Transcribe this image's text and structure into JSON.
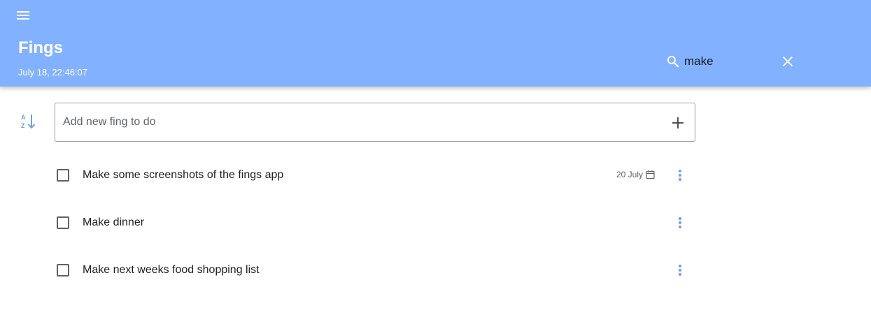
{
  "app": {
    "title": "Fings",
    "timestamp": "July 18, 22:46:07"
  },
  "search": {
    "value": "make",
    "icon": "search-icon",
    "clear_icon": "close-icon"
  },
  "toolbar": {
    "menu_icon": "menu-icon",
    "sort_icon": "sort-alpha-icon"
  },
  "add_todo": {
    "placeholder": "Add new fing to do",
    "add_icon": "plus-icon"
  },
  "todos": [
    {
      "text": "Make some screenshots of the fings app",
      "due": "20 July",
      "checked": false
    },
    {
      "text": "Make dinner",
      "due": "",
      "checked": false
    },
    {
      "text": "Make next weeks food shopping list",
      "due": "",
      "checked": false
    }
  ],
  "colors": {
    "appbar": "#82b1ff",
    "accent": "#6d9eeb"
  }
}
